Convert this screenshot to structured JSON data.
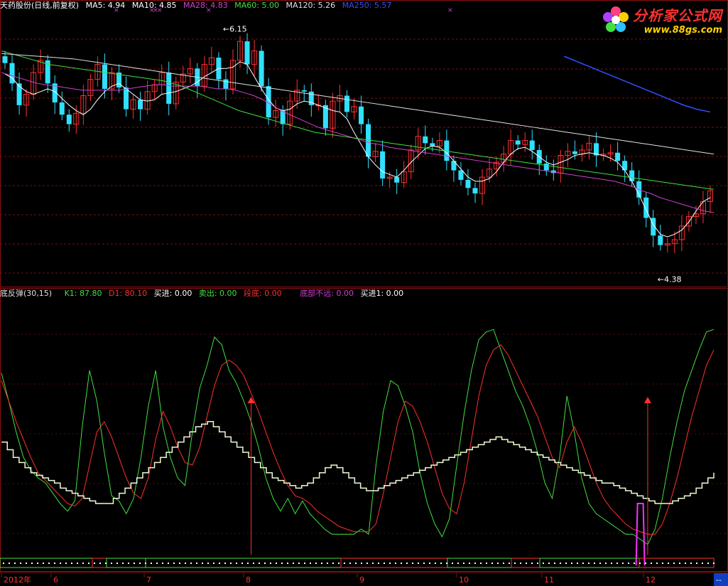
{
  "upper_header": {
    "title": "天药股份(日线,前复权)",
    "items": [
      {
        "label": "MA5: 4.94",
        "color": "#ffffff"
      },
      {
        "label": "MA10: 4.85",
        "color": "#ffffff"
      },
      {
        "label": "MA28: 4.83",
        "color": "#d040d0"
      },
      {
        "label": "MA60: 5.00",
        "color": "#40e040"
      },
      {
        "label": "MA120: 5.26",
        "color": "#e0e0e0"
      },
      {
        "label": "MA250: 5.57",
        "color": "#3050ff"
      }
    ],
    "markers": "× ×××"
  },
  "lower_header": {
    "title": "底反弹(30,15)",
    "items": [
      {
        "label": "K1: 87.80",
        "color": "#40e040"
      },
      {
        "label": "D1: 80.10",
        "color": "#ff3030"
      },
      {
        "label": "买进: 0.00",
        "color": "#ffffff"
      },
      {
        "label": "卖出: 0.00",
        "color": "#40e040"
      },
      {
        "label": "段底: 0.00",
        "color": "#ff3030"
      },
      {
        "label": "底部不远: 0.00",
        "color": "#d040d0"
      },
      {
        "label": "买进1: 0.00",
        "color": "#ffffff"
      }
    ]
  },
  "logo": {
    "title": "分析家公式网",
    "url": "www.88gs.com"
  },
  "x_axis": {
    "labels": [
      "2012年",
      "6",
      "7",
      "8",
      "9",
      "10",
      "11",
      "12"
    ],
    "end_marker": "--"
  },
  "colors": {
    "up": "#ff3030",
    "down": "#30e0ff",
    "ma5": "#ffffff",
    "ma10": "#ffff80",
    "ma28": "#d040d0",
    "ma60": "#40e040",
    "ma120": "#e0e0e0",
    "ma250": "#3050ff",
    "grid": "#7a1010"
  },
  "chart_data": [
    {
      "type": "candlestick",
      "title": "天药股份(日线,前复权)",
      "price_range": [
        4.3,
        6.3
      ],
      "annotations": [
        {
          "label": "6.15",
          "value": 6.15
        },
        {
          "label": "4.38",
          "value": 4.38
        }
      ],
      "close": [
        5.93,
        5.78,
        5.62,
        5.7,
        5.86,
        5.95,
        5.78,
        5.64,
        5.55,
        5.48,
        5.56,
        5.69,
        5.81,
        5.92,
        5.74,
        5.86,
        5.75,
        5.59,
        5.66,
        5.59,
        5.72,
        5.77,
        5.86,
        5.63,
        5.79,
        5.85,
        5.89,
        5.76,
        5.92,
        5.97,
        5.81,
        5.74,
        5.95,
        6.09,
        5.92,
        6.02,
        5.76,
        5.53,
        5.58,
        5.48,
        5.65,
        5.73,
        5.72,
        5.62,
        5.62,
        5.45,
        5.65,
        5.69,
        5.57,
        5.61,
        5.48,
        5.24,
        5.28,
        5.08,
        5.09,
        5.05,
        5.13,
        5.29,
        5.39,
        5.34,
        5.32,
        5.36,
        5.21,
        5.14,
        5.07,
        5.01,
        4.97,
        5.09,
        5.15,
        5.2,
        5.26,
        5.36,
        5.33,
        5.36,
        5.29,
        5.19,
        5.14,
        5.12,
        5.25,
        5.28,
        5.26,
        5.29,
        5.34,
        5.25,
        5.26,
        5.27,
        5.21,
        5.14,
        5.06,
        4.94,
        4.79,
        4.66,
        4.59,
        4.6,
        4.63,
        4.73,
        4.8,
        4.82,
        4.91,
        4.99
      ],
      "ma5": [
        5.85,
        5.82,
        5.76,
        5.72,
        5.7,
        5.72,
        5.74,
        5.72,
        5.67,
        5.62,
        5.58,
        5.55,
        5.59,
        5.66,
        5.72,
        5.76,
        5.78,
        5.74,
        5.7,
        5.66,
        5.65,
        5.66,
        5.7,
        5.71,
        5.72,
        5.74,
        5.76,
        5.79,
        5.83,
        5.86,
        5.89,
        5.89,
        5.9,
        5.94,
        5.92,
        5.83,
        5.74,
        5.66,
        5.6,
        5.58,
        5.59,
        5.63,
        5.65,
        5.64,
        5.62,
        5.6,
        5.58,
        5.57,
        5.52,
        5.42,
        5.33,
        5.24,
        5.18,
        5.13,
        5.11,
        5.09,
        5.14,
        5.2,
        5.25,
        5.3,
        5.32,
        5.31,
        5.27,
        5.21,
        5.15,
        5.09,
        5.06,
        5.06,
        5.08,
        5.13,
        5.2,
        5.26,
        5.3,
        5.31,
        5.28,
        5.24,
        5.2,
        5.18,
        5.2,
        5.22,
        5.25,
        5.26,
        5.27,
        5.26,
        5.25,
        5.23,
        5.2,
        5.14,
        5.06,
        4.96,
        4.85,
        4.74,
        4.67,
        4.65,
        4.67,
        4.7,
        4.76,
        4.84,
        4.91,
        4.94
      ],
      "ma28": [
        5.86,
        5.84,
        5.82,
        5.8,
        5.78,
        5.77,
        5.76,
        5.75,
        5.74,
        5.73,
        5.73,
        5.73,
        5.73,
        5.73,
        5.74,
        5.75,
        5.76,
        5.77,
        5.77,
        5.76,
        5.76,
        5.76,
        5.76,
        5.75,
        5.74,
        5.74,
        5.73,
        5.71,
        5.69,
        5.66,
        5.62,
        5.58,
        5.55,
        5.52,
        5.49,
        5.46,
        5.44,
        5.42,
        5.4,
        5.38,
        5.36,
        5.34,
        5.33,
        5.31,
        5.3,
        5.29,
        5.28,
        5.27,
        5.26,
        5.25,
        5.24,
        5.23,
        5.22,
        5.21,
        5.2,
        5.19,
        5.18,
        5.17,
        5.16,
        5.15,
        5.14,
        5.13,
        5.12,
        5.11,
        5.1,
        5.09,
        5.08,
        5.07,
        5.06,
        5.04,
        5.02,
        4.99,
        4.97,
        4.94,
        4.92,
        4.9,
        4.88,
        4.86,
        4.84,
        4.83
      ],
      "ma60": [
        6.02,
        6.0,
        5.98,
        5.96,
        5.94,
        5.92,
        5.91,
        5.9,
        5.89,
        5.88,
        5.87,
        5.86,
        5.85,
        5.84,
        5.83,
        5.82,
        5.81,
        5.8,
        5.78,
        5.76,
        5.73,
        5.7,
        5.67,
        5.64,
        5.61,
        5.58,
        5.56,
        5.54,
        5.52,
        5.5,
        5.48,
        5.46,
        5.44,
        5.42,
        5.41,
        5.4,
        5.39,
        5.38,
        5.37,
        5.36,
        5.35,
        5.34,
        5.33,
        5.32,
        5.31,
        5.3,
        5.29,
        5.28,
        5.27,
        5.26,
        5.25,
        5.24,
        5.23,
        5.22,
        5.21,
        5.2,
        5.19,
        5.18,
        5.17,
        5.16,
        5.15,
        5.14,
        5.13,
        5.12,
        5.11,
        5.1,
        5.09,
        5.08,
        5.07,
        5.06,
        5.05,
        5.04,
        5.03,
        5.02,
        5.01,
        5.0
      ],
      "ma120": [
        6.0,
        5.99,
        5.98,
        5.97,
        5.96,
        5.94,
        5.92,
        5.9,
        5.88,
        5.86,
        5.84,
        5.82,
        5.8,
        5.78,
        5.76,
        5.74,
        5.72,
        5.7,
        5.68,
        5.66,
        5.64,
        5.62,
        5.6,
        5.58,
        5.56,
        5.54,
        5.52,
        5.5,
        5.48,
        5.46,
        5.44,
        5.42,
        5.4,
        5.38,
        5.36,
        5.34,
        5.32,
        5.3,
        5.28,
        5.26
      ],
      "ma250": [
        5.98,
        5.94,
        5.9,
        5.86,
        5.82,
        5.78,
        5.74,
        5.7,
        5.66,
        5.62,
        5.59,
        5.57
      ]
    },
    {
      "type": "line",
      "title": "底反弹(30,15)",
      "value_range": [
        0,
        100
      ],
      "series": [
        {
          "name": "K1",
          "values": [
            71,
            60,
            48,
            38,
            33,
            30,
            28,
            24,
            20,
            17,
            21,
            50,
            72,
            60,
            40,
            23,
            21,
            16,
            22,
            38,
            58,
            72,
            50,
            38,
            30,
            27,
            48,
            65,
            74,
            85,
            82,
            72,
            67,
            60,
            52,
            42,
            30,
            22,
            17,
            22,
            16,
            21,
            16,
            13,
            10,
            8,
            8,
            8,
            8,
            10,
            8,
            35,
            56,
            68,
            66,
            58,
            48,
            32,
            20,
            12,
            7,
            14,
            35,
            55,
            72,
            84,
            87,
            88,
            80,
            72,
            64,
            58,
            50,
            40,
            28,
            22,
            38,
            62,
            48,
            30,
            20,
            16,
            14,
            12,
            10,
            8,
            8,
            6,
            4,
            10,
            22,
            38,
            52,
            64,
            72,
            80,
            87,
            88
          ]
        },
        {
          "name": "D1",
          "values": [
            68,
            60,
            52,
            45,
            38,
            32,
            29,
            26,
            23,
            20,
            19,
            22,
            35,
            48,
            52,
            46,
            38,
            30,
            24,
            22,
            30,
            45,
            56,
            50,
            42,
            36,
            35,
            42,
            54,
            66,
            74,
            76,
            74,
            70,
            63,
            56,
            48,
            40,
            33,
            27,
            23,
            22,
            20,
            17,
            15,
            13,
            11,
            10,
            9,
            9,
            9,
            12,
            24,
            38,
            52,
            60,
            58,
            52,
            44,
            34,
            24,
            18,
            16,
            28,
            45,
            62,
            74,
            80,
            82,
            78,
            72,
            66,
            60,
            54,
            46,
            38,
            34,
            44,
            50,
            44,
            36,
            28,
            22,
            18,
            15,
            12,
            10,
            9,
            8,
            8,
            12,
            20,
            30,
            42,
            54,
            64,
            74,
            80
          ]
        },
        {
          "name": "买进1",
          "values": [
            44,
            41,
            38,
            36,
            34,
            32,
            31,
            30,
            29,
            28,
            26,
            25,
            24,
            23,
            22,
            21,
            20,
            20,
            20,
            22,
            24,
            26,
            28,
            30,
            32,
            34,
            36,
            38,
            40,
            42,
            44,
            46,
            48,
            50,
            51,
            52,
            50,
            48,
            46,
            44,
            42,
            40,
            38,
            36,
            34,
            32,
            30,
            29,
            28,
            27,
            26,
            27,
            28,
            30,
            32,
            34,
            35,
            34,
            32,
            30,
            28,
            26,
            25,
            25,
            26,
            27,
            28,
            29,
            30,
            31,
            32,
            33,
            34,
            35,
            36,
            37,
            38,
            39,
            40,
            41,
            42,
            43,
            44,
            45,
            46,
            45,
            44,
            43,
            42,
            41,
            40,
            39,
            38,
            37,
            36,
            35,
            34,
            33,
            32,
            31,
            30,
            29,
            28,
            28,
            27,
            26,
            25,
            24,
            23,
            22,
            21,
            20,
            20,
            20,
            21,
            22,
            23,
            24,
            26,
            28,
            30,
            32
          ]
        }
      ],
      "signals": [
        {
          "label": "buy",
          "index": 34
        },
        {
          "label": "buy",
          "index": 88
        }
      ],
      "spike": {
        "name": "底部不远",
        "index": 87,
        "value": 20
      }
    }
  ]
}
